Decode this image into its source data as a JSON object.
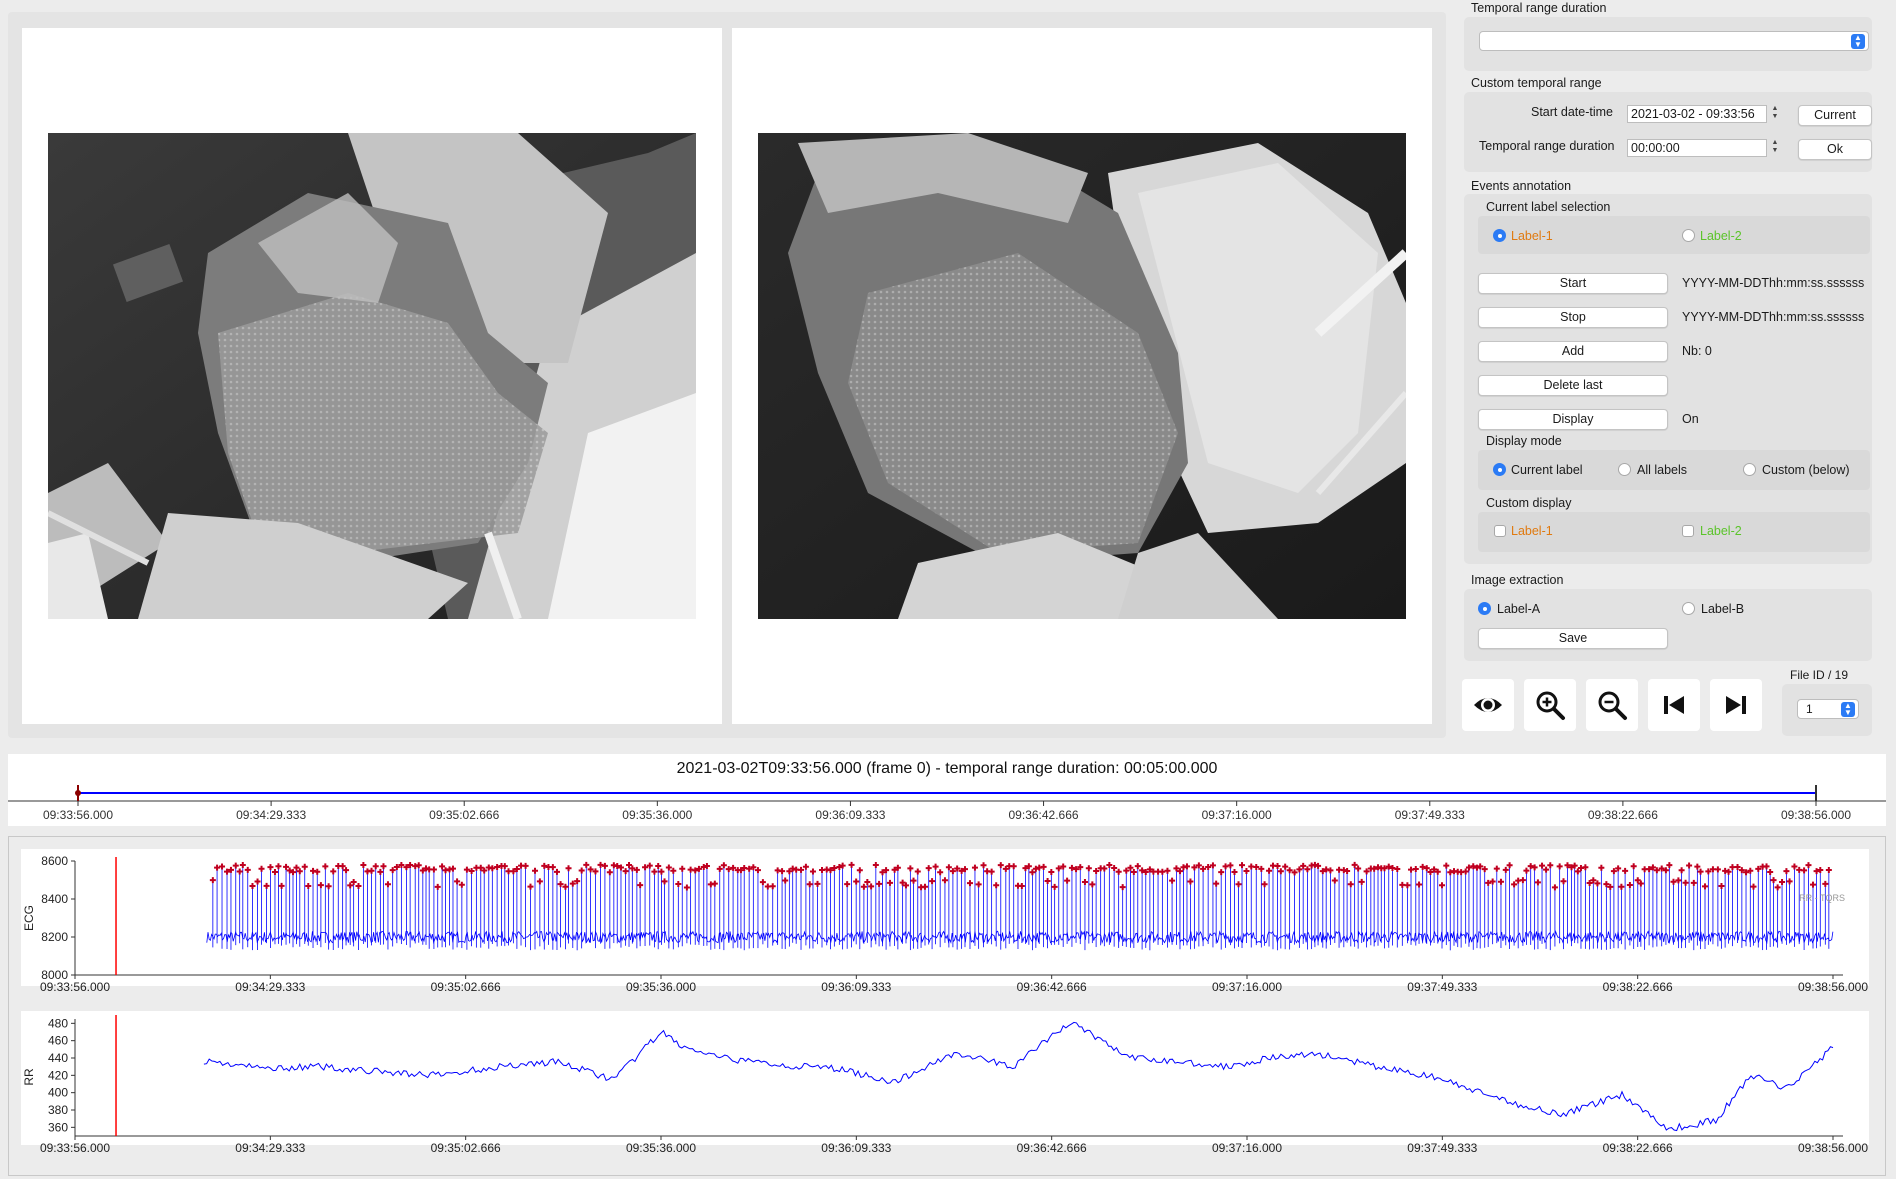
{
  "controls": {
    "temporal_range_duration": {
      "title": "Temporal range duration",
      "value": ""
    },
    "custom_temporal_range": {
      "title": "Custom temporal range",
      "start_label": "Start date-time",
      "start_value": "2021-03-02 - 09:33:56",
      "current_button": "Current",
      "duration_label": "Temporal range duration",
      "duration_value": "00:00:00",
      "ok_button": "Ok"
    },
    "events_annotation": {
      "title": "Events annotation",
      "label_selection_title": "Current label selection",
      "labels": [
        {
          "text": "Label-1",
          "color": "#e07a10",
          "selected": true
        },
        {
          "text": "Label-2",
          "color": "#5bc42a",
          "selected": false
        }
      ],
      "start_button": "Start",
      "start_value": "YYYY-MM-DDThh:mm:ss.ssssss",
      "stop_button": "Stop",
      "stop_value": "YYYY-MM-DDThh:mm:ss.ssssss",
      "add_button": "Add",
      "nb_value": "Nb: 0",
      "delete_last_button": "Delete last",
      "display_button": "Display",
      "display_state": "On",
      "display_mode_title": "Display mode",
      "display_modes": [
        "Current label",
        "All labels",
        "Custom (below)"
      ],
      "custom_display_title": "Custom display",
      "custom_labels": [
        "Label-1",
        "Label-2"
      ]
    },
    "image_extraction": {
      "title": "Image extraction",
      "options": [
        "Label-A",
        "Label-B"
      ],
      "save_button": "Save"
    },
    "file_id": {
      "label": "File ID / 19",
      "value": "1"
    },
    "toolbar_icons": [
      "eye-icon",
      "zoom-in-icon",
      "zoom-out-icon",
      "skip-start-icon",
      "skip-end-icon"
    ]
  },
  "timeline": {
    "title": "2021-03-02T09:33:56.000 (frame 0) - temporal range duration: 00:05:00.000",
    "ticks": [
      "09:33:56.000",
      "09:34:29.333",
      "09:35:02.666",
      "09:35:36.000",
      "09:36:09.333",
      "09:36:42.666",
      "09:37:16.000",
      "09:37:49.333",
      "09:38:22.666",
      "09:38:56.000"
    ],
    "line_color": "#0000ff",
    "cursor_color": "#8b0000"
  },
  "chart_data": [
    {
      "type": "line",
      "ylabel": "ECG",
      "legend": "RR - TQRS",
      "yticks": [
        "8600",
        "8400",
        "8200",
        "8000"
      ],
      "ylim": [
        8000,
        8600
      ],
      "xticks": [
        "09:33:56.000",
        "09:34:29.333",
        "09:35:02.666",
        "09:35:36.000",
        "09:36:09.333",
        "09:36:42.666",
        "09:37:16.000",
        "09:37:49.333",
        "09:38:22.666",
        "09:38:56.000"
      ],
      "xlim": [
        "09:33:56.000",
        "09:38:56.000"
      ],
      "signal_start": "09:34:18.500",
      "baseline": 8200,
      "peak_markers_level": 8560,
      "series_color": "#0000ff",
      "marker_color": "#c00020",
      "cursor_color": "#ff0000",
      "cursor_x": "09:34:03.000"
    },
    {
      "type": "line",
      "ylabel": "RR",
      "yticks": [
        "480",
        "460",
        "440",
        "420",
        "400",
        "380",
        "360"
      ],
      "ylim": [
        350,
        485
      ],
      "xticks": [
        "09:33:56.000",
        "09:34:29.333",
        "09:35:02.666",
        "09:35:36.000",
        "09:36:09.333",
        "09:36:42.666",
        "09:37:16.000",
        "09:37:49.333",
        "09:38:22.666",
        "09:38:56.000"
      ],
      "x_seconds_from_start": [
        22,
        32,
        42,
        52,
        62,
        72,
        82,
        92,
        100,
        104,
        110,
        118,
        124,
        130,
        140,
        150,
        160,
        170,
        180,
        190,
        196,
        204,
        212,
        222,
        232,
        244,
        254,
        264,
        272,
        280,
        286,
        292,
        300
      ],
      "values": [
        437,
        428,
        430,
        424,
        420,
        430,
        436,
        415,
        470,
        452,
        440,
        434,
        430,
        428,
        412,
        446,
        430,
        482,
        440,
        435,
        430,
        440,
        445,
        430,
        418,
        390,
        375,
        398,
        358,
        368,
        420,
        405,
        452
      ],
      "series_color": "#0000ff",
      "cursor_color": "#ff0000",
      "cursor_x": "09:34:03.000"
    }
  ]
}
